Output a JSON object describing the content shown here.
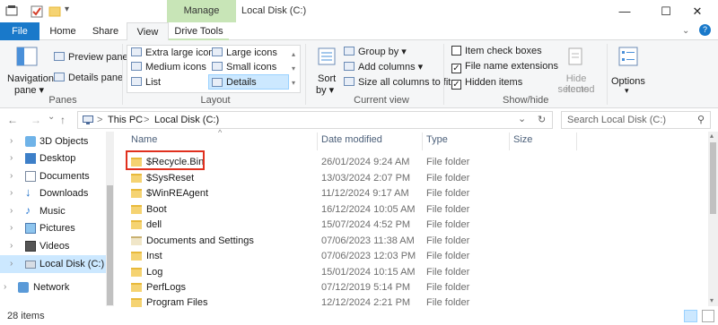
{
  "title_bar": {
    "manage_tab": "Manage",
    "title": "Local Disk (C:)",
    "minimize": "—",
    "maximize": "☐",
    "close": "✕"
  },
  "tabs": {
    "file": "File",
    "home": "Home",
    "share": "Share",
    "view": "View",
    "drive_tools": "Drive Tools"
  },
  "ribbon": {
    "panes": {
      "navigation_pane": "Navigation",
      "navigation_pane_2": "pane ▾",
      "preview_pane": "Preview pane",
      "details_pane": "Details pane",
      "label": "Panes"
    },
    "layout": {
      "extra_large": "Extra large icons",
      "large": "Large icons",
      "medium": "Medium icons",
      "small": "Small icons",
      "list": "List",
      "details": "Details",
      "label": "Layout"
    },
    "current_view": {
      "sort": "Sort",
      "sort_2": "by ▾",
      "group_by": "Group by ▾",
      "add_columns": "Add columns ▾",
      "size_all": "Size all columns to fit",
      "label": "Current view"
    },
    "show_hide": {
      "item_checkboxes": "Item check boxes",
      "file_name_ext": "File name extensions",
      "hidden_items": "Hidden items",
      "hide_selected": "Hide selected",
      "hide_selected_2": "items",
      "label": "Show/hide",
      "item_checkboxes_checked": false,
      "file_name_ext_checked": true,
      "hidden_items_checked": true
    },
    "options": {
      "label": "Options",
      "arrow": "▾"
    }
  },
  "address": {
    "back": "←",
    "forward": "→",
    "recent": "⌄",
    "up": "↑",
    "crumb_this_pc": "This PC",
    "crumb_sep_1": ">",
    "crumb_local_disk": "Local Disk (C:)",
    "crumb_sep_0": ">",
    "dropdown": "⌄",
    "refresh": "↻",
    "search_placeholder": "Search Local Disk (C:)"
  },
  "nav_items": [
    {
      "label": "3D Objects",
      "icon": "3d-objects-icon"
    },
    {
      "label": "Desktop",
      "icon": "desktop-icon"
    },
    {
      "label": "Documents",
      "icon": "documents-icon"
    },
    {
      "label": "Downloads",
      "icon": "downloads-icon"
    },
    {
      "label": "Music",
      "icon": "music-icon"
    },
    {
      "label": "Pictures",
      "icon": "pictures-icon"
    },
    {
      "label": "Videos",
      "icon": "videos-icon"
    },
    {
      "label": "Local Disk (C:)",
      "icon": "drive-icon"
    },
    {
      "label": "Network",
      "icon": "network-icon"
    }
  ],
  "columns": {
    "name": "Name",
    "date": "Date modified",
    "type": "Type",
    "size": "Size"
  },
  "files": [
    {
      "name": "$Recycle.Bin",
      "date": "26/01/2024 9:24 AM",
      "type": "File folder"
    },
    {
      "name": "$SysReset",
      "date": "13/03/2024 2:07 PM",
      "type": "File folder"
    },
    {
      "name": "$WinREAgent",
      "date": "11/12/2024 9:17 AM",
      "type": "File folder"
    },
    {
      "name": "Boot",
      "date": "16/12/2024 10:05 AM",
      "type": "File folder"
    },
    {
      "name": "dell",
      "date": "15/07/2024 4:52 PM",
      "type": "File folder"
    },
    {
      "name": "Documents and Settings",
      "date": "07/06/2023 11:38 AM",
      "type": "File folder"
    },
    {
      "name": "Inst",
      "date": "07/06/2023 12:03 PM",
      "type": "File folder"
    },
    {
      "name": "Log",
      "date": "15/01/2024 10:15 AM",
      "type": "File folder"
    },
    {
      "name": "PerfLogs",
      "date": "07/12/2019 5:14 PM",
      "type": "File folder"
    },
    {
      "name": "Program Files",
      "date": "12/12/2024 2:21 PM",
      "type": "File folder"
    }
  ],
  "status": {
    "count": "28 items"
  },
  "colors": {
    "file_tab": "#1979ca",
    "manage_tab": "#c8e5b7",
    "selection": "#cce8ff",
    "highlight_box": "#e0301e",
    "folder": "#f5d372"
  }
}
